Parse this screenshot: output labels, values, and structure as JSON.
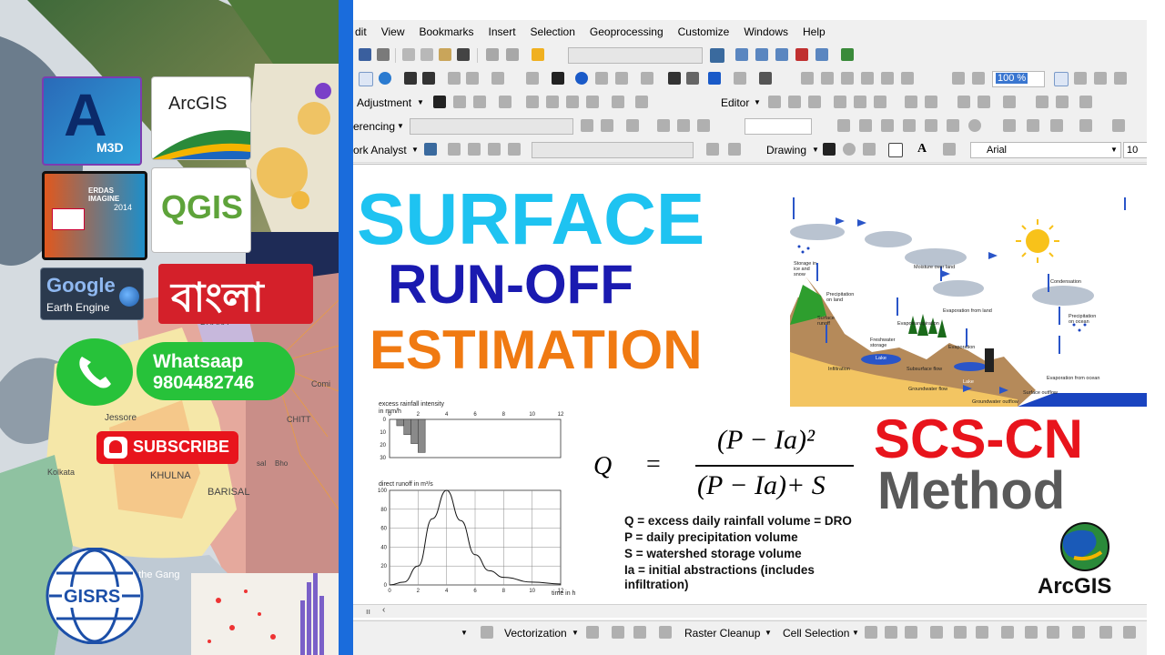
{
  "menu": {
    "items": [
      "dit",
      "View",
      "Bookmarks",
      "Insert",
      "Selection",
      "Geoprocessing",
      "Customize",
      "Windows",
      "Help"
    ]
  },
  "toolbars": {
    "zoom_value": "100 %",
    "adjustment_label": "Adjustment",
    "editor_label": "Editor",
    "georeferencing_label": "erencing",
    "network_analyst_label": "ork Analyst",
    "drawing_label": "Drawing",
    "font_name": "Arial",
    "font_size": "10",
    "text_tool": "A"
  },
  "statusbar": {
    "vectorization_label": "Vectorization",
    "raster_cleanup_label": "Raster Cleanup",
    "cell_selection_label": "Cell Selection"
  },
  "headline": {
    "line1": "SURFACE",
    "line2": "RUN-OFF",
    "line3": "ESTIMATION",
    "method_line1": "SCS-CN",
    "method_line2": "Method"
  },
  "colors": {
    "surface": "#1ec3f1",
    "runoff": "#1a1ab0",
    "estimation": "#f07a12",
    "scs": "#e8141c",
    "method": "#5a5a5a",
    "side_bar": "#1a6cdc"
  },
  "formula": {
    "lhs": "Q",
    "equals": "=",
    "numerator": "(P − Ia)²",
    "denominator": "(P − Ia)+ S",
    "legend": [
      "Q = excess daily rainfall volume = DRO",
      "P = daily precipitation volume",
      "S = watershed storage volume",
      "Ia = initial abstractions (includes",
      "infiltration)"
    ]
  },
  "hydrograph": {
    "top_label": "excess rainfall intensity",
    "top_unit": "in mm/h",
    "top_y_ticks": [
      "0",
      "10",
      "20",
      "30"
    ],
    "bottom_label": "direct runoff in m³/s",
    "bottom_y_ticks": [
      "100",
      "80",
      "60",
      "40",
      "20",
      "0"
    ],
    "x_ticks": [
      "0",
      "2",
      "4",
      "6",
      "8",
      "10",
      "12"
    ],
    "x_unit": "time in h",
    "rain_bars": [
      5,
      12,
      19,
      26
    ],
    "runoff_curve": [
      [
        0,
        0
      ],
      [
        1,
        3
      ],
      [
        2,
        20
      ],
      [
        3,
        70
      ],
      [
        4,
        100
      ],
      [
        5,
        68
      ],
      [
        6,
        32
      ],
      [
        7,
        15
      ],
      [
        8,
        8
      ],
      [
        10,
        3
      ],
      [
        12,
        1
      ]
    ]
  },
  "water_cycle": {
    "labels": [
      "Storage in ice and snow",
      "Precipitation on land",
      "Surface runoff",
      "Infiltration",
      "Freshwater storage",
      "Lake",
      "Evapotranspiration",
      "Subsurface flow",
      "Moisture over land",
      "Evaporation from land",
      "Evaporation",
      "Lake",
      "Groundwater flow",
      "Groundwater outflow",
      "Condensation",
      "Precipitation on ocean",
      "Evaporation from ocean",
      "Surface outflow"
    ]
  },
  "sidebar": {
    "autodesk_label": "M3D",
    "arcgis_label": "ArcGIS",
    "erdas_title": "ERDAS IMAGINE",
    "erdas_year": "2014",
    "qgis_label": "QGIS",
    "google_label": "Google",
    "earth_engine_label": "Earth Engine",
    "bangla_label": "বাংলা",
    "whatsapp_label": "Whatsaap",
    "whatsapp_number": "9804482746",
    "subscribe_label": "SUBSCRIBE",
    "gisrs_label": "GISRS",
    "map_labels": [
      "Jessore",
      "KHULNA",
      "BARISAL",
      "Kolkata",
      "DHAKA",
      "CHITT",
      "Comi",
      "sal",
      "Bho",
      "of the Gang"
    ]
  },
  "arcgis_logo": {
    "label": "ArcGIS"
  }
}
